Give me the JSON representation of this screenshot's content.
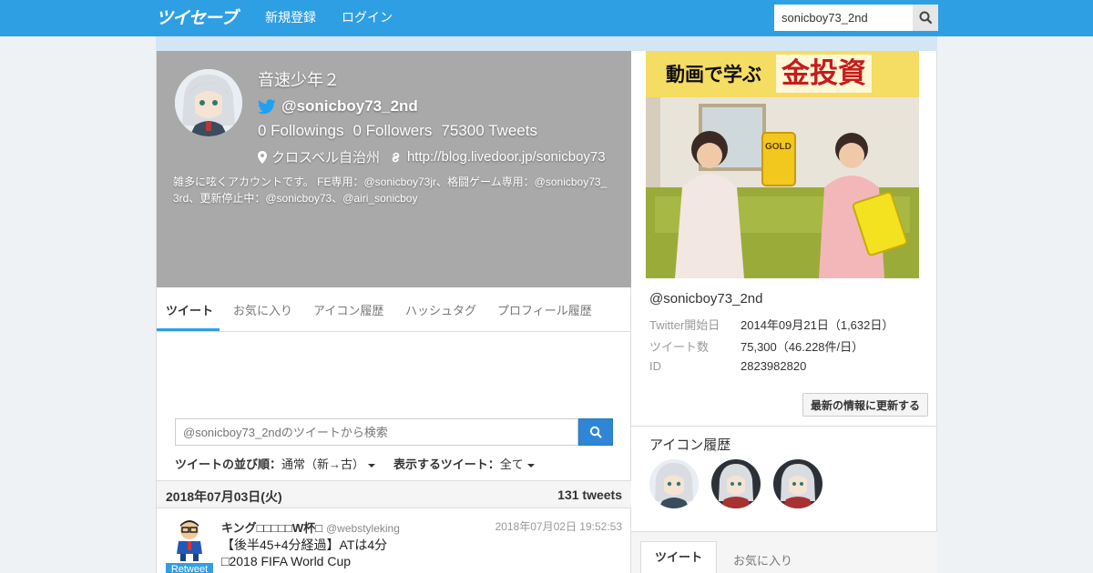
{
  "header": {
    "logo": "ツイセーブ",
    "nav": [
      "新規登録",
      "ログイン"
    ],
    "search_value": "sonicboy73_2nd"
  },
  "profile": {
    "name": "音速少年２",
    "handle": "@sonicboy73_2nd",
    "followings_label": "0 Followings",
    "followers_label": "0 Followers",
    "tweets_label": "75300 Tweets",
    "location": "クロスベル自治州",
    "url": "http://blog.livedoor.jp/sonicboy73",
    "bio": "雑多に呟くアカウントです。 FE専用：@sonicboy73jr、格闘ゲーム専用：@sonicboy73_3rd、更新停止中：@sonicboy73、@airi_sonicboy"
  },
  "tabs": [
    "ツイート",
    "お気に入り",
    "アイコン履歴",
    "ハッシュタグ",
    "プロフィール履歴"
  ],
  "tweet_search": {
    "placeholder": "@sonicboy73_2ndのツイートから検索"
  },
  "sort": {
    "order_label": "ツイートの並び順：",
    "order_value": "通常（新→古）",
    "show_label": "表示するツイート：",
    "show_value": "全て"
  },
  "date_bar": {
    "date": "2018年07月03日(火)",
    "count": "131 tweets"
  },
  "tweet": {
    "user": "キング□□□□□W杯□",
    "handle": "@webstyleking",
    "time": "2018年07月02日 19:52:53",
    "badge": "Retweet",
    "lines": [
      "【後半45+4分経過】ATは4分",
      "□2018 FIFA World Cup"
    ]
  },
  "ad": {
    "headline_a": "動画で学ぶ",
    "headline_b": "金投資",
    "gold_label": "GOLD"
  },
  "info": {
    "handle": "@sonicboy73_2nd",
    "rows": [
      {
        "key": "Twitter開始日",
        "value": "2014年09月21日（1,632日）"
      },
      {
        "key": "ツイート数",
        "value": "75,300（46.228件/日）"
      },
      {
        "key": "ID",
        "value": "2823982820"
      }
    ],
    "refresh_label": "最新の情報に更新する"
  },
  "icon_history": {
    "title": "アイコン履歴"
  },
  "bottom_tabs": [
    "ツイート",
    "お気に入り"
  ],
  "colors": {
    "accent": "#2f9fe3",
    "cover": "#a9a9a9"
  }
}
